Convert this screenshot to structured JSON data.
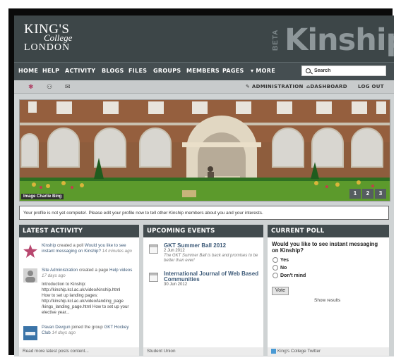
{
  "brand": {
    "logo": {
      "line1": "KING'S",
      "line2": "College",
      "line3": "LONDON"
    },
    "beta": "BETA",
    "name": "Kinship"
  },
  "nav": {
    "items": [
      "HOME",
      "HELP",
      "ACTIVITY",
      "BLOGS",
      "FILES",
      "GROUPS",
      "MEMBERS",
      "PAGES",
      "▾ MORE"
    ],
    "search_placeholder": "Search"
  },
  "toolbar": {
    "icons": [
      "star-icon",
      "friends-icon",
      "mail-icon"
    ],
    "administration": "ADMINISTRATION",
    "dashboard": "DASHBOARD",
    "logout": "LOG OUT"
  },
  "banner": {
    "caption": "Image Charlie Bing",
    "slides": [
      "1",
      "2",
      "3"
    ]
  },
  "notice": "Your profile is not yet complete!. Please edit your profile now to tell other Kinship members about you and your interests.",
  "activity": {
    "title": "LATEST ACTIVITY",
    "footer": "Read more latest posts content...",
    "items": [
      {
        "actor": "Kinship",
        "action": "created a poll",
        "object": "Would you like to see instant messaging on Kinship?",
        "time": "14 minutes ago"
      },
      {
        "actor": "Site Administration",
        "action": "created a page",
        "object": "Help videos",
        "time": "17 days ago"
      },
      {
        "actor": "Pavan Devgun",
        "action": "joined the group",
        "object": "GKT Hockey Club",
        "time": "14 days ago"
      }
    ],
    "excerpt": [
      "Introduction to Kinship:",
      "http://kinship.kcl.ac.uk/video/kinship.html",
      "How to set up landing pages:",
      "http://kinship.kcl.ac.uk/video/landing_page",
      "/kings_landing_page.html How to set up your",
      "elective year..."
    ]
  },
  "events": {
    "title": "UPCOMING EVENTS",
    "footer": "Student Union",
    "items": [
      {
        "title": "GKT Summer Ball 2012",
        "date": "2 Jun 2012",
        "desc": "The GKT Summer Ball is back and promises to be better than ever!"
      },
      {
        "title": "International Journal of Web Based Communities",
        "date": "30 Jun 2012",
        "desc": ""
      }
    ]
  },
  "poll": {
    "title": "CURRENT POLL",
    "question": "Would you like to see instant messaging on Kinship?",
    "options": [
      "Yes",
      "No",
      "Don't mind"
    ],
    "vote": "Vote",
    "results": "Show results",
    "footer": "King's College Twitter"
  },
  "colors": {
    "header": "#3d4648",
    "nav": "#454e51",
    "link": "#3d5a78"
  }
}
